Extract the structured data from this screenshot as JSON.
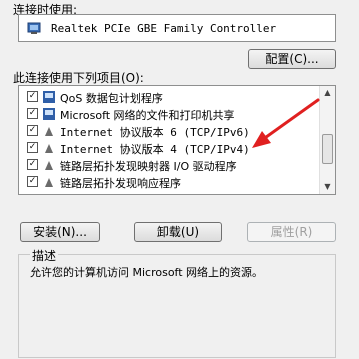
{
  "connect_using_label": "连接时使用:",
  "adapter": {
    "icon": "network-adapter-icon",
    "name": "Realtek PCIe GBE Family Controller"
  },
  "configure_label": "配置(C)...",
  "items_label": "此连接使用下列项目(O):",
  "items": [
    {
      "label": "QoS 数据包计划程序",
      "checked": true,
      "icon": "network-service-icon"
    },
    {
      "label": "Microsoft 网络的文件和打印机共享",
      "checked": true,
      "icon": "network-service-icon"
    },
    {
      "label": "Internet 协议版本 6 (TCP/IPv6)",
      "checked": true,
      "icon": "protocol-icon"
    },
    {
      "label": "Internet 协议版本 4 (TCP/IPv4)",
      "checked": true,
      "icon": "protocol-icon"
    },
    {
      "label": "链路层拓扑发现映射器 I/O 驱动程序",
      "checked": true,
      "icon": "protocol-icon"
    },
    {
      "label": "链路层拓扑发现响应程序",
      "checked": true,
      "icon": "protocol-icon"
    }
  ],
  "install_label": "安装(N)...",
  "uninstall_label": "卸载(U)",
  "properties_label": "属性(R)",
  "description_title": "描述",
  "description_text": "允许您的计算机访问 Microsoft 网络上的资源。",
  "annotation_arrow_color": "#e02020"
}
